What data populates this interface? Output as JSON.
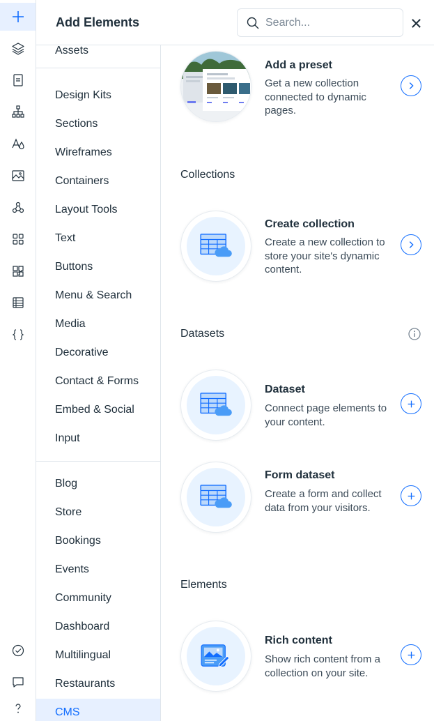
{
  "colors": {
    "accent": "#116dff",
    "accent_bg": "#e7f0ff",
    "text": "#20303c",
    "muted": "#3b4a57",
    "divider": "#dfe5eb",
    "thumb_bg": "#e8f3ff"
  },
  "rail": {
    "icons": [
      "plus-icon",
      "layers-icon",
      "page-icon",
      "sitemap-icon",
      "typography-icon",
      "image-icon",
      "apps-icon",
      "grid-icon",
      "puzzle-icon",
      "table-icon",
      "code-braces-icon",
      "checklist-icon",
      "chat-icon",
      "help-icon"
    ],
    "active": "plus-icon"
  },
  "header": {
    "title": "Add Elements",
    "search": {
      "placeholder": "Search...",
      "value": ""
    }
  },
  "categories": {
    "group0": [
      "Assets"
    ],
    "group1": [
      "Design Kits",
      "Sections",
      "Wireframes",
      "Containers",
      "Layout Tools",
      "Text",
      "Buttons",
      "Menu & Search",
      "Media",
      "Decorative",
      "Contact & Forms",
      "Embed & Social",
      "Input"
    ],
    "group2": [
      "Blog",
      "Store",
      "Bookings",
      "Events",
      "Community",
      "Dashboard",
      "Multilingual",
      "Restaurants",
      "CMS"
    ],
    "active": "CMS"
  },
  "content": {
    "preset": {
      "title": "Add a preset",
      "desc": "Get a new collection connected to dynamic pages."
    },
    "collections_title": "Collections",
    "create_collection": {
      "title": "Create collection",
      "desc": "Create a new collection to store your site's dynamic content."
    },
    "datasets_title": "Datasets",
    "dataset": {
      "title": "Dataset",
      "desc": "Connect page elements to your content."
    },
    "form_dataset": {
      "title": "Form dataset",
      "desc": "Create a form and collect data from your visitors."
    },
    "elements_title": "Elements",
    "rich_content": {
      "title": "Rich content",
      "desc": "Show rich content from a collection on your site."
    }
  }
}
